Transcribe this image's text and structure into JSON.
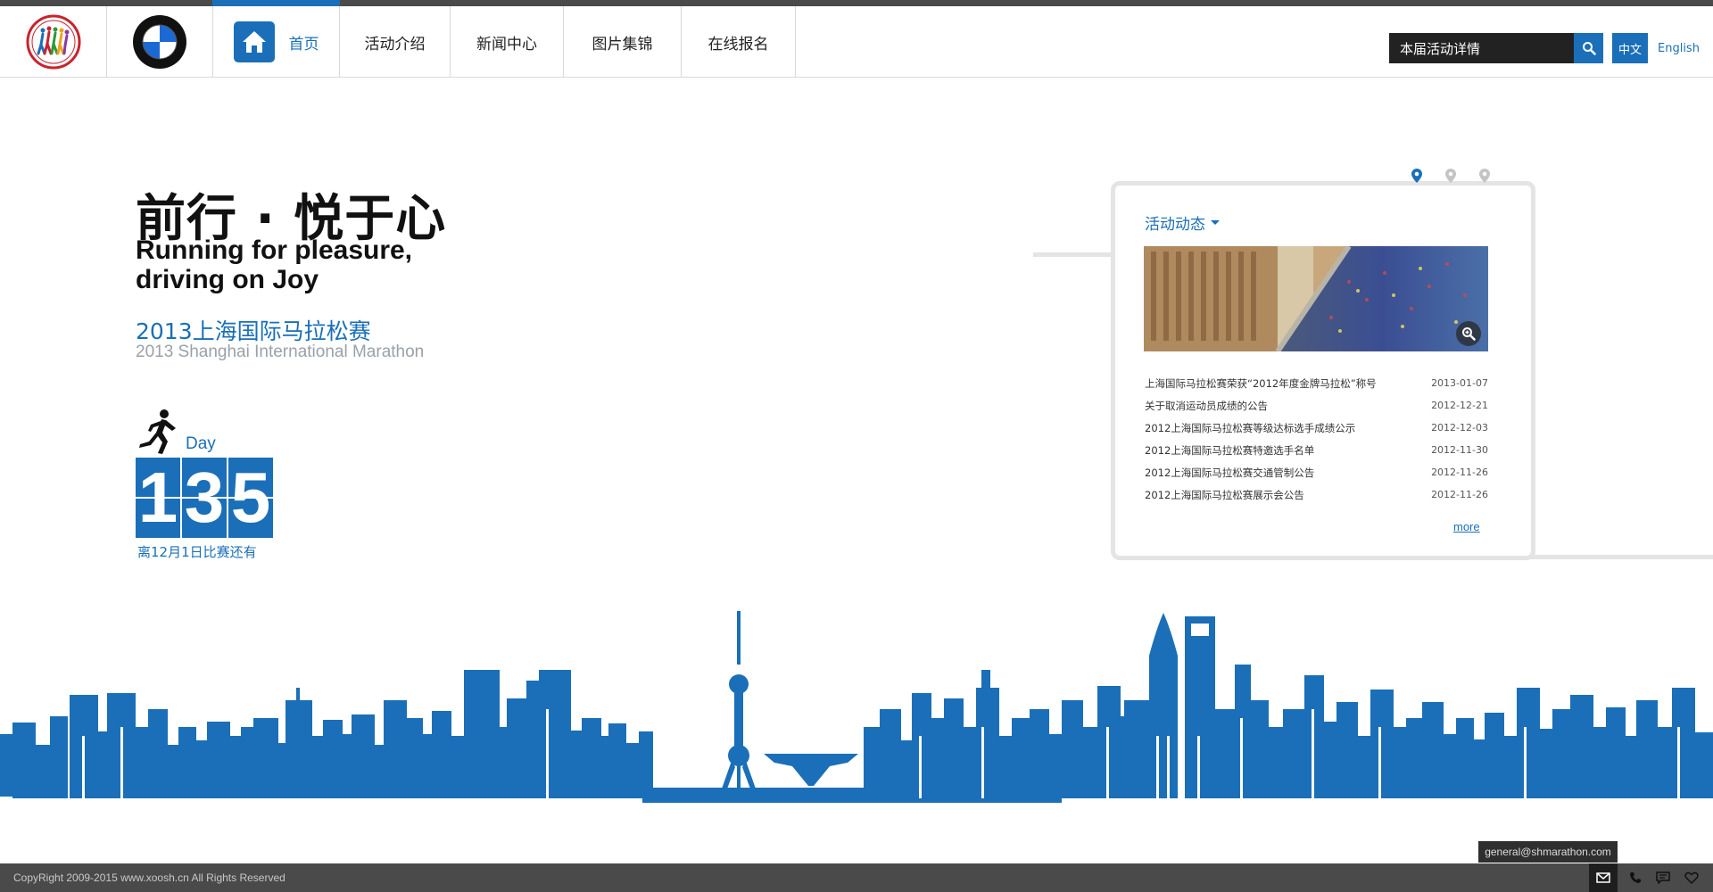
{
  "nav": {
    "home": "首页",
    "about": "活动介绍",
    "news": "新闻中心",
    "photos": "图片集锦",
    "signup": "在线报名"
  },
  "search": {
    "value": "本届活动详情",
    "icon": "search-icon"
  },
  "lang": {
    "cn": "中文",
    "en": "English"
  },
  "hero": {
    "slogan_cn": "前行 · 悦于心",
    "slogan_en": "Running for pleasure, driving on Joy",
    "event_cn": "2013上海国际马拉松赛",
    "event_en": "2013 Shanghai International Marathon"
  },
  "countdown": {
    "label": "Day",
    "digits": [
      "1",
      "3",
      "5"
    ],
    "caption": "离12月1日比赛还有"
  },
  "news": {
    "title": "活动动态",
    "items": [
      {
        "title": "上海国际马拉松赛荣获“2012年度金牌马拉松”称号",
        "date": "2013-01-07"
      },
      {
        "title": "关于取消运动员成绩的公告",
        "date": "2012-12-21"
      },
      {
        "title": "2012上海国际马拉松赛等级达标选手成绩公示",
        "date": "2012-12-03"
      },
      {
        "title": "2012上海国际马拉松赛特邀选手名单",
        "date": "2012-11-30"
      },
      {
        "title": "2012上海国际马拉松赛交通管制公告",
        "date": "2012-11-26"
      },
      {
        "title": "2012上海国际马拉松赛展示会公告",
        "date": "2012-11-26"
      }
    ],
    "more": "more",
    "active_slide": 1,
    "slide_count": 3
  },
  "footer": {
    "copyright": "CopyRight 2009-2015 www.xoosh.cn All Rights Reserved",
    "email": "general@shmarathon.com"
  },
  "colors": {
    "brand_blue": "#1a6fb8",
    "dark_bar": "#4a4a4a",
    "panel_border": "#e4e4e4"
  }
}
